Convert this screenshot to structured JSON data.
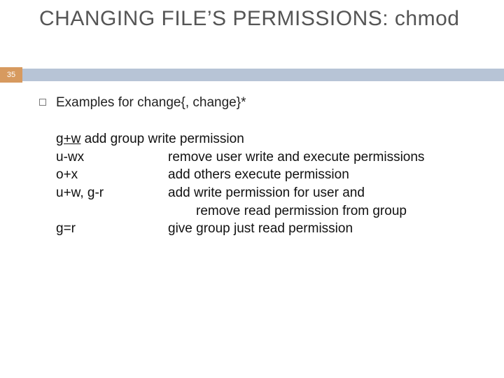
{
  "slide": {
    "title": "CHANGING FILE’S PERMISSIONS: chmod",
    "page_number": "35",
    "bullet": "Examples for change{, change}*",
    "examples": {
      "row1_cmd": "g+w",
      "row1_rest": " add group write permission",
      "row2_cmd": "u-wx",
      "row2_desc": "remove user write and execute permissions",
      "row3_cmd": "o+x",
      "row3_desc": "add others execute permission",
      "row4_cmd": "u+w, g-r",
      "row4_desc": "add write permission for user and",
      "row4_cont": "remove read permission from group",
      "row5_cmd": "g=r",
      "row5_desc": "give group just read permission"
    }
  }
}
